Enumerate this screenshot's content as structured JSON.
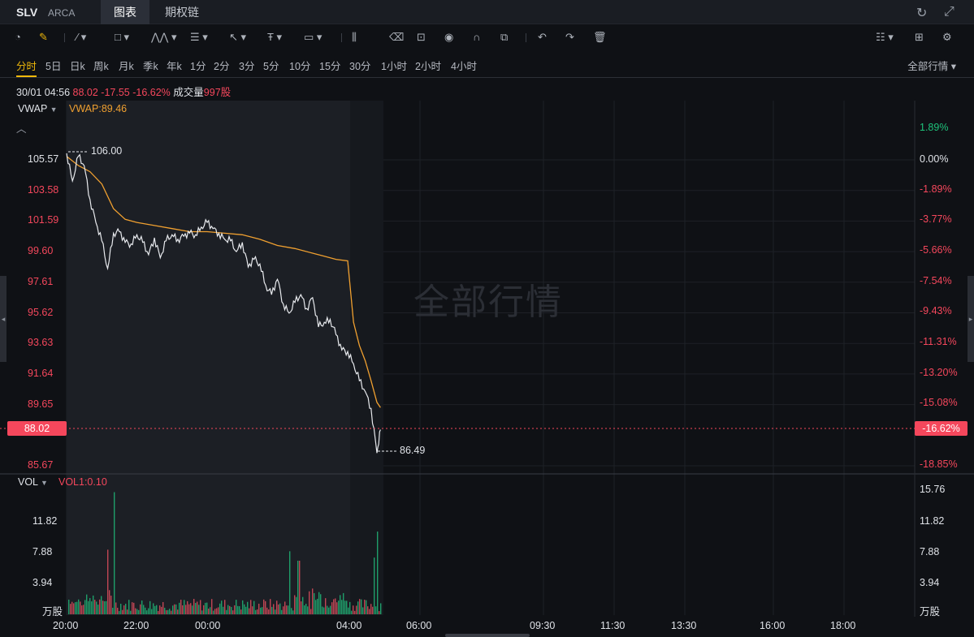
{
  "header": {
    "symbol": "SLV",
    "exchange": "ARCA",
    "tabs": [
      {
        "label": "图表",
        "active": true
      },
      {
        "label": "期权链",
        "active": false
      }
    ],
    "refresh_icon": "refresh-icon",
    "fullscreen_icon": "fullscreen-icon"
  },
  "toolbar": {
    "tools": [
      {
        "name": "speedometer-icon",
        "glyph": "◔"
      },
      {
        "name": "draw-pencil-icon",
        "glyph": "✎",
        "accent": true
      },
      {
        "name": "line-tool-icon",
        "glyph": "⁄ ▾"
      },
      {
        "name": "rectangle-tool-icon",
        "glyph": "□ ▾"
      },
      {
        "name": "pattern-tool-icon",
        "glyph": "⋀⋀ ▾"
      },
      {
        "name": "fibonacci-tool-icon",
        "glyph": "☰ ▾"
      },
      {
        "name": "arrow-tool-icon",
        "glyph": "↖ ▾"
      },
      {
        "name": "text-tool-icon",
        "glyph": "Ŧ ▾"
      },
      {
        "name": "label-tool-icon",
        "glyph": "▭ ▾"
      },
      {
        "name": "measure-tool-icon",
        "glyph": "⫼"
      },
      {
        "name": "eraser-icon",
        "glyph": "⌫"
      },
      {
        "name": "lock-icon",
        "glyph": "⊡"
      },
      {
        "name": "eye-icon",
        "glyph": "◉"
      },
      {
        "name": "magnet-icon",
        "glyph": "∩"
      },
      {
        "name": "layers-icon",
        "glyph": "⧉"
      },
      {
        "name": "undo-icon",
        "glyph": "↶"
      },
      {
        "name": "redo-icon",
        "glyph": "↷"
      },
      {
        "name": "trash-icon",
        "glyph": "🗑"
      },
      {
        "name": "layout-icon",
        "glyph": "☷ ▾"
      },
      {
        "name": "grid-icon",
        "glyph": "⊞"
      },
      {
        "name": "settings-gear-icon",
        "glyph": "⚙"
      }
    ]
  },
  "periods": [
    "分时",
    "5日",
    "日k",
    "周k",
    "月k",
    "季k",
    "年k",
    "1分",
    "2分",
    "3分",
    "5分",
    "10分",
    "15分",
    "30分",
    "1小时",
    "2小时",
    "4小时"
  ],
  "active_period": "分时",
  "market_selector": "全部行情",
  "info": {
    "datetime": "30/01 04:56",
    "price": "88.02",
    "change": "-17.55",
    "change_pct": "-16.62%",
    "volume_label": "成交量",
    "volume_value": "997股"
  },
  "price_panel": {
    "indicator": "VWAP",
    "indicator_value": "VWAP:89.46",
    "y_labels": [
      "105.57",
      "103.58",
      "101.59",
      "99.60",
      "97.61",
      "95.62",
      "93.63",
      "91.64",
      "89.65",
      "85.67"
    ],
    "pct_labels": [
      "1.89%",
      "0.00%",
      "-1.89%",
      "-3.77%",
      "-5.66%",
      "-7.54%",
      "-9.43%",
      "-11.31%",
      "-13.20%",
      "-15.08%",
      "-18.85%"
    ],
    "current_price_tag": "88.02",
    "current_pct_tag": "-16.62%",
    "high_marker": "106.00",
    "low_marker": "86.49",
    "watermark": "全部行情"
  },
  "volume_panel": {
    "indicator": "VOL",
    "indicator_value": "VOL1:0.10",
    "left_labels": [
      "11.82",
      "7.88",
      "3.94",
      "万股"
    ],
    "right_labels": [
      "15.76",
      "11.82",
      "7.88",
      "3.94",
      "万股"
    ]
  },
  "x_labels": [
    "20:00",
    "22:00",
    "00:00",
    "04:00",
    "06:00",
    "09:30",
    "11:30",
    "13:30",
    "16:00",
    "18:00"
  ],
  "colors": {
    "up": "#f5475c",
    "down": "#1ec27a",
    "vwap": "#f0a030",
    "accent": "#f0b90b"
  },
  "chart_data": {
    "type": "line",
    "price_series": {
      "name": "SLV",
      "x": [
        "20:00",
        "20:10",
        "20:20",
        "20:30",
        "20:40",
        "20:50",
        "21:00",
        "21:10",
        "21:20",
        "21:30",
        "21:40",
        "21:50",
        "22:00",
        "22:10",
        "22:20",
        "22:30",
        "22:40",
        "22:50",
        "23:00",
        "23:10",
        "23:20",
        "23:30",
        "23:40",
        "23:50",
        "00:00",
        "00:10",
        "00:20",
        "00:30",
        "00:40",
        "00:50",
        "01:00",
        "01:10",
        "01:20",
        "01:30",
        "01:40",
        "01:50",
        "02:00",
        "02:10",
        "02:20",
        "02:30",
        "02:40",
        "02:50",
        "03:00",
        "03:10",
        "03:20",
        "03:30",
        "03:40",
        "03:50",
        "04:00",
        "04:10",
        "04:20",
        "04:30",
        "04:40",
        "04:50",
        "04:56"
      ],
      "values": [
        106.0,
        104.2,
        105.8,
        105.2,
        103.0,
        101.5,
        100.3,
        98.5,
        100.8,
        100.9,
        100.2,
        100.1,
        100.7,
        100.2,
        99.4,
        100.5,
        99.2,
        100.3,
        100.7,
        100.4,
        100.6,
        100.8,
        100.7,
        101.2,
        101.5,
        101.1,
        100.8,
        100.4,
        100.3,
        99.6,
        100.2,
        98.6,
        99.1,
        98.8,
        97.4,
        96.8,
        97.8,
        96.2,
        95.6,
        96.3,
        96.8,
        95.9,
        96.6,
        94.7,
        95.0,
        95.2,
        94.2,
        93.2,
        93.1,
        92.3,
        91.2,
        90.5,
        89.4,
        86.5,
        88.02
      ],
      "high": 106.0,
      "low": 86.49
    },
    "vwap_series": {
      "name": "VWAP",
      "x": [
        "20:00",
        "20:20",
        "20:40",
        "21:00",
        "21:20",
        "21:40",
        "22:00",
        "22:30",
        "23:00",
        "23:30",
        "00:00",
        "00:30",
        "01:00",
        "01:30",
        "02:00",
        "02:30",
        "03:00",
        "03:20",
        "03:40",
        "04:00",
        "04:10",
        "04:20",
        "04:30",
        "04:40",
        "04:50",
        "04:56"
      ],
      "values": [
        105.8,
        105.2,
        104.8,
        104.0,
        102.4,
        101.7,
        101.5,
        101.3,
        101.1,
        100.9,
        100.9,
        100.8,
        100.7,
        100.4,
        100.0,
        99.8,
        99.5,
        99.3,
        99.1,
        99.0,
        95.0,
        93.5,
        92.5,
        91.2,
        89.8,
        89.46
      ]
    },
    "volume_series": {
      "name": "VOL",
      "unit": "万股",
      "spikes": [
        {
          "x": "21:20",
          "value": 15.5
        },
        {
          "x": "21:10",
          "value": 8.2
        },
        {
          "x": "02:20",
          "value": 8.0
        },
        {
          "x": "02:35",
          "value": 6.8
        },
        {
          "x": "04:50",
          "value": 10.5
        },
        {
          "x": "04:45",
          "value": 7.2
        }
      ]
    },
    "ylim_price": [
      85.0,
      106.6
    ],
    "ylim_volume": [
      0,
      15.76
    ],
    "xlabel": "",
    "ylabel": ""
  }
}
